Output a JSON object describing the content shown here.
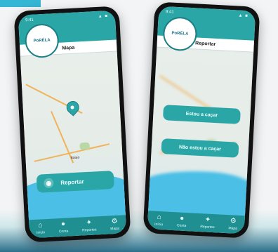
{
  "left_phone": {
    "status_time": "9:41",
    "status_icons": "▲ ■",
    "logo_text": "PoRÉLA",
    "title": "Mapa",
    "city_label": "Baiao",
    "cta_label": "Reportar",
    "nav": [
      {
        "label": "Início",
        "icon": "home-icon",
        "glyph": "⌂"
      },
      {
        "label": "Conta",
        "icon": "user-icon",
        "glyph": "●"
      },
      {
        "label": "Reportes",
        "icon": "clipboard-icon",
        "glyph": "✦"
      },
      {
        "label": "Mapa",
        "icon": "settings-icon",
        "glyph": "⚙"
      }
    ]
  },
  "right_phone": {
    "status_time": "9:41",
    "status_icons": "▲ ■",
    "logo_text": "PoRÉLA",
    "title": "Reportar",
    "buttons": [
      "Estou a caçar",
      "Não estou a caçar"
    ],
    "nav": [
      {
        "label": "Início",
        "icon": "home-icon",
        "glyph": "⌂"
      },
      {
        "label": "Conta",
        "icon": "user-icon",
        "glyph": "●"
      },
      {
        "label": "Reportes",
        "icon": "clipboard-icon",
        "glyph": "✦"
      },
      {
        "label": "Mapa",
        "icon": "settings-icon",
        "glyph": "⚙"
      }
    ]
  },
  "colors": {
    "brand": "#2aa6a6",
    "brand_dark": "#1f8f92"
  }
}
